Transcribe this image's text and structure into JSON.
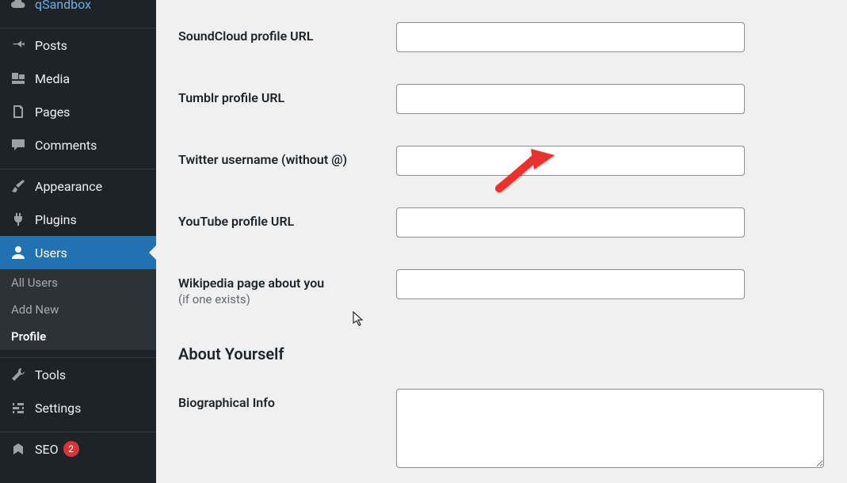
{
  "sidebar": {
    "items": [
      {
        "label": "qSandbox"
      },
      {
        "label": "Posts"
      },
      {
        "label": "Media"
      },
      {
        "label": "Pages"
      },
      {
        "label": "Comments"
      },
      {
        "label": "Appearance"
      },
      {
        "label": "Plugins"
      },
      {
        "label": "Users"
      },
      {
        "label": "Tools"
      },
      {
        "label": "Settings"
      },
      {
        "label": "SEO",
        "badge": "2"
      }
    ],
    "submenu": [
      {
        "label": "All Users"
      },
      {
        "label": "Add New"
      },
      {
        "label": "Profile"
      }
    ]
  },
  "form": {
    "soundcloud_label": "SoundCloud profile URL",
    "soundcloud_value": "",
    "tumblr_label": "Tumblr profile URL",
    "tumblr_value": "",
    "twitter_label": "Twitter username (without @)",
    "twitter_value": "",
    "youtube_label": "YouTube profile URL",
    "youtube_value": "",
    "wikipedia_label": "Wikipedia page about you",
    "wikipedia_sublabel": "(if one exists)",
    "wikipedia_value": "",
    "about_heading": "About Yourself",
    "bio_label": "Biographical Info",
    "bio_value": ""
  }
}
